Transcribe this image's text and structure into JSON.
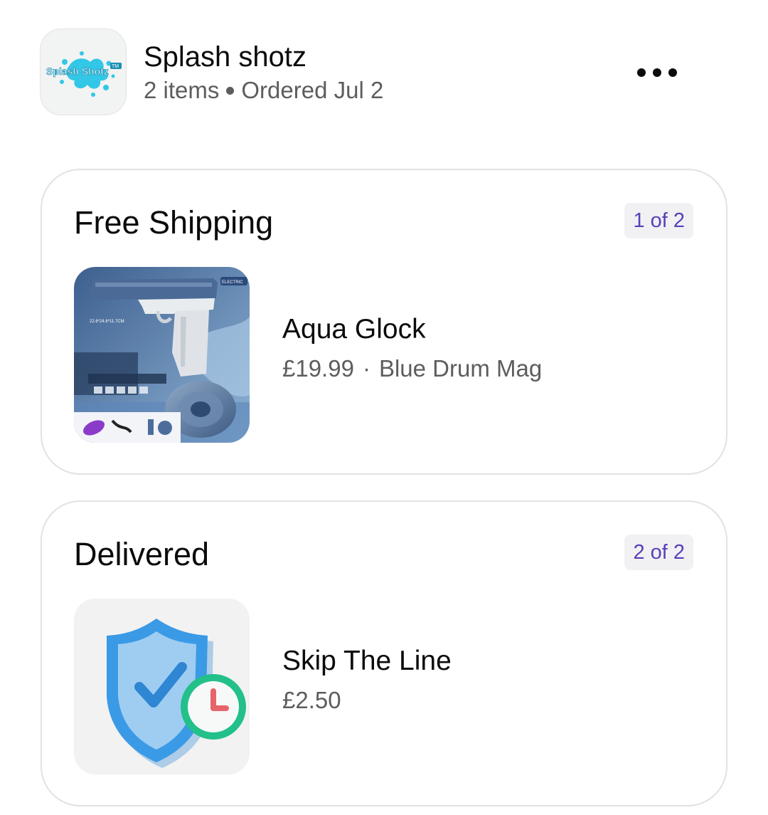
{
  "store": {
    "logo_text": "Splash Shotz",
    "logo_mark": "TM",
    "name": "Splash shotz",
    "item_count": "2 items",
    "ordered": "Ordered Jul 2",
    "more_icon": "more-horizontal-icon"
  },
  "shipments": [
    {
      "title": "Free Shipping",
      "badge": "1 of 2",
      "item": {
        "name": "Aqua Glock",
        "price": "£19.99",
        "separator": "·",
        "variant": "Blue Drum Mag",
        "image_labels": [
          "22.6*24.6*11.7CM",
          "ELECTRIC"
        ]
      }
    },
    {
      "title": "Delivered",
      "badge": "2 of 2",
      "item": {
        "name": "Skip The Line",
        "price": "£2.50",
        "image_icon": "shield-check-clock-icon"
      }
    }
  ],
  "colors": {
    "badge_text": "#5a3fb8",
    "badge_bg": "#f1f1f4",
    "secondary_text": "#5d5d5d",
    "card_border": "#e2e2e2",
    "logo_splash": "#32c7e6"
  }
}
